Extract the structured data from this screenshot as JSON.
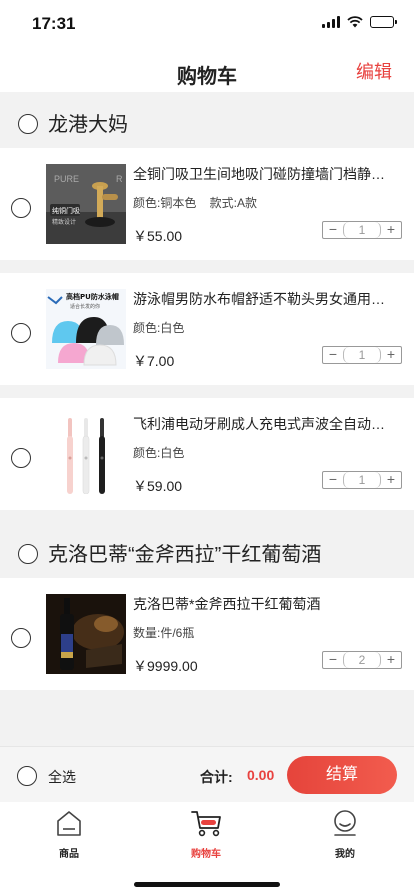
{
  "status": {
    "time": "17:31"
  },
  "nav": {
    "title": "购物车",
    "edit": "编辑"
  },
  "shops": [
    {
      "name": "龙港大妈",
      "items": [
        {
          "name": "全铜门吸卫生间地吸门碰防撞墙门档静音门吸",
          "spec": "颜色:铜本色    款式:A款",
          "price": "￥55.00",
          "qty": "1",
          "image_text": [
            "PURE",
            "R",
            "纯铜门吸",
            "精致设计"
          ]
        },
        {
          "name": "游泳帽男防水布帽舒适不勒头男女通用长发护耳",
          "spec": "颜色:白色",
          "price": "￥7.00",
          "qty": "1",
          "image_text": [
            "高档PU防水泳帽",
            "适合长发的你"
          ]
        },
        {
          "name": "飞利浦电动牙刷成人充电式声波全自动超声波",
          "spec": "颜色:白色",
          "price": "￥59.00",
          "qty": "1"
        }
      ]
    },
    {
      "name": "克洛巴蒂“金斧西拉”干红葡萄酒",
      "items": [
        {
          "name": "克洛巴蒂*金斧西拉干红葡萄酒",
          "spec": "数量:件/6瓶",
          "price": "￥9999.00",
          "qty": "2"
        }
      ]
    }
  ],
  "stepper": {
    "minus": "−",
    "plus": "+"
  },
  "footer": {
    "select_all": "全选",
    "total_label": "合计:",
    "total_value": "0.00",
    "checkout": "结算"
  },
  "tabs": [
    {
      "label": "商品",
      "icon": "shop-icon",
      "active": false
    },
    {
      "label": "购物车",
      "icon": "cart-icon",
      "active": true
    },
    {
      "label": "我的",
      "icon": "profile-icon",
      "active": false
    }
  ],
  "colors": {
    "accent": "#e8423f",
    "background": "#f2f2f2"
  }
}
